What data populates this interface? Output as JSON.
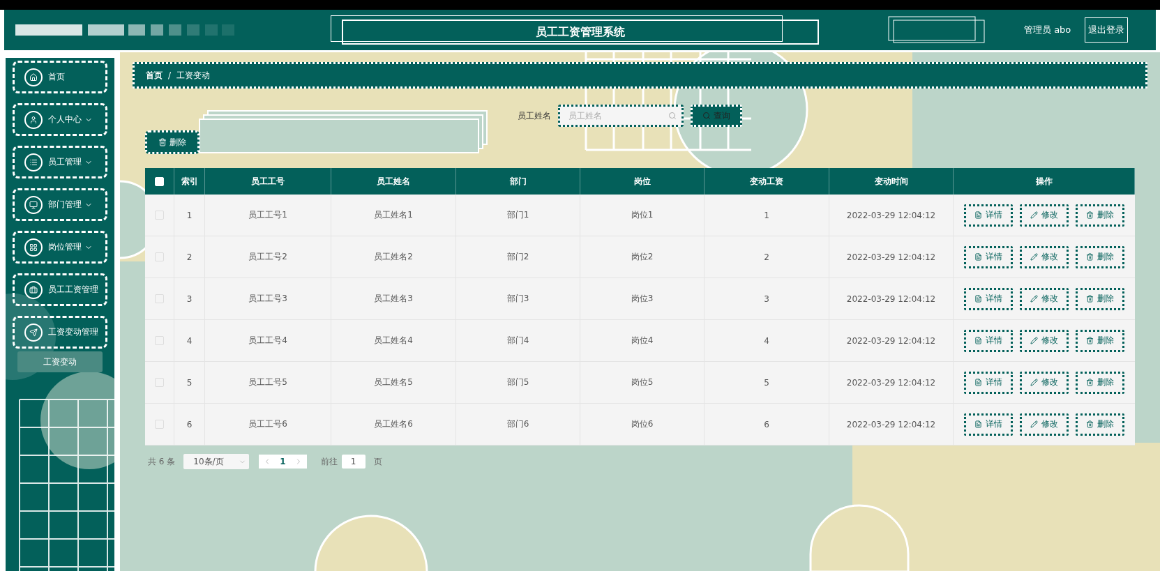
{
  "header": {
    "title": "员工工资管理系统",
    "user": "管理员 abo",
    "logout": "退出登录"
  },
  "sidebar": {
    "items": [
      {
        "label": "首页",
        "expandable": false,
        "selected": false
      },
      {
        "label": "个人中心",
        "expandable": true,
        "selected": false
      },
      {
        "label": "员工管理",
        "expandable": true,
        "selected": false
      },
      {
        "label": "部门管理",
        "expandable": true,
        "selected": false
      },
      {
        "label": "岗位管理",
        "expandable": true,
        "selected": false
      },
      {
        "label": "员工工资管理",
        "expandable": false,
        "selected": false
      },
      {
        "label": "工资变动管理",
        "expandable": false,
        "selected": false,
        "children": [
          {
            "label": "工资变动",
            "selected": true
          }
        ]
      }
    ]
  },
  "breadcrumb": {
    "items": [
      "首页",
      "工资变动"
    ],
    "separator": "/"
  },
  "search": {
    "label": "员工姓名",
    "placeholder": "员工姓名",
    "button": "查询"
  },
  "actions": {
    "delete": "删除"
  },
  "table": {
    "select_all_checked": false,
    "columns": [
      "索引",
      "员工工号",
      "员工姓名",
      "部门",
      "岗位",
      "变动工资",
      "变动时间",
      "操作"
    ],
    "rows": [
      {
        "checked": false,
        "cells": [
          "1",
          "员工工号1",
          "员工姓名1",
          "部门1",
          "岗位1",
          "1",
          "2022-03-29 12:04:12"
        ],
        "actions": [
          "详情",
          "修改",
          "删除"
        ]
      },
      {
        "checked": false,
        "cells": [
          "2",
          "员工工号2",
          "员工姓名2",
          "部门2",
          "岗位2",
          "2",
          "2022-03-29 12:04:12"
        ],
        "actions": [
          "详情",
          "修改",
          "删除"
        ]
      },
      {
        "checked": false,
        "cells": [
          "3",
          "员工工号3",
          "员工姓名3",
          "部门3",
          "岗位3",
          "3",
          "2022-03-29 12:04:12"
        ],
        "actions": [
          "详情",
          "修改",
          "删除"
        ]
      },
      {
        "checked": false,
        "cells": [
          "4",
          "员工工号4",
          "员工姓名4",
          "部门4",
          "岗位4",
          "4",
          "2022-03-29 12:04:12"
        ],
        "actions": [
          "详情",
          "修改",
          "删除"
        ]
      },
      {
        "checked": false,
        "cells": [
          "5",
          "员工工号5",
          "员工姓名5",
          "部门5",
          "岗位5",
          "5",
          "2022-03-29 12:04:12"
        ],
        "actions": [
          "详情",
          "修改",
          "删除"
        ]
      },
      {
        "checked": false,
        "cells": [
          "6",
          "员工工号6",
          "员工姓名6",
          "部门6",
          "岗位6",
          "6",
          "2022-03-29 12:04:12"
        ],
        "actions": [
          "详情",
          "修改",
          "删除"
        ]
      }
    ]
  },
  "pagination": {
    "total": "共 6 条",
    "page_size": "10条/页",
    "pages": [
      {
        "label": "1",
        "selected": true
      }
    ],
    "goto_label": "前往",
    "goto_value": "1",
    "page_suffix": "页"
  }
}
